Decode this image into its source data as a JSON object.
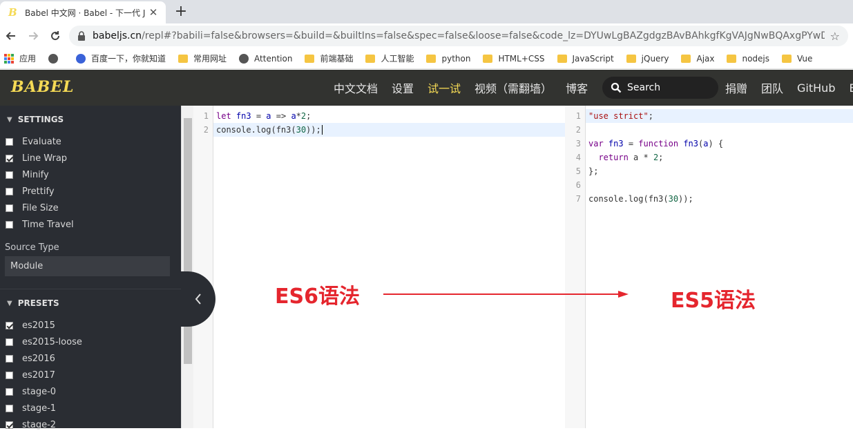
{
  "browser": {
    "tab_title": "Babel 中文网 · Babel - 下一代 J",
    "tab_close": "✕",
    "new_tab": "+",
    "url_host": "babeljs.cn",
    "url_rest": "/repl#?babili=false&browsers=&build=&builtIns=false&spec=false&loose=false&code_lz=DYUwLgBAZgdgzBAvBAhkgfKgVAJgNwBQAxgPYwDOJ..."
  },
  "bookmarks": [
    {
      "label": "应用",
      "icon": "apps-icon"
    },
    {
      "label": "",
      "icon": "globe-icon"
    },
    {
      "label": "百度一下，你就知道",
      "icon": "baidu-paw-icon"
    },
    {
      "label": "常用网址",
      "icon": "folder-icon"
    },
    {
      "label": "Attention",
      "icon": "globe-icon"
    },
    {
      "label": "前端基础",
      "icon": "folder-icon"
    },
    {
      "label": "人工智能",
      "icon": "folder-icon"
    },
    {
      "label": "python",
      "icon": "folder-icon"
    },
    {
      "label": "HTML+CSS",
      "icon": "folder-icon"
    },
    {
      "label": "JavaScript",
      "icon": "folder-icon"
    },
    {
      "label": "jQuery",
      "icon": "folder-icon"
    },
    {
      "label": "Ajax",
      "icon": "folder-icon"
    },
    {
      "label": "nodejs",
      "icon": "folder-icon"
    },
    {
      "label": "Vue",
      "icon": "folder-icon"
    }
  ],
  "header": {
    "logo": "BABEL",
    "nav": [
      "中文文档",
      "设置",
      "试一试",
      "视频（需翻墙）",
      "博客"
    ],
    "active_nav": "试一试",
    "search_label": "Search",
    "nav_right": [
      "捐赠",
      "团队",
      "GitHub",
      "Ba"
    ]
  },
  "sidebar": {
    "settings_title": "SETTINGS",
    "settings": [
      {
        "label": "Evaluate",
        "checked": false
      },
      {
        "label": "Line Wrap",
        "checked": true
      },
      {
        "label": "Minify",
        "checked": false
      },
      {
        "label": "Prettify",
        "checked": false
      },
      {
        "label": "File Size",
        "checked": false
      },
      {
        "label": "Time Travel",
        "checked": false
      }
    ],
    "source_type_label": "Source Type",
    "source_type_value": "Module",
    "presets_title": "PRESETS",
    "presets": [
      {
        "label": "es2015",
        "checked": true
      },
      {
        "label": "es2015-loose",
        "checked": false
      },
      {
        "label": "es2016",
        "checked": false
      },
      {
        "label": "es2017",
        "checked": false
      },
      {
        "label": "stage-0",
        "checked": false
      },
      {
        "label": "stage-1",
        "checked": false
      },
      {
        "label": "stage-2",
        "checked": true
      }
    ]
  },
  "input_editor": {
    "line_numbers": [
      "1",
      "2"
    ],
    "lines": [
      "let fn3 = a => a*2;",
      "console.log(fn3(30));"
    ]
  },
  "output_editor": {
    "line_numbers": [
      "1",
      "2",
      "3",
      "4",
      "5",
      "6",
      "7"
    ],
    "lines": [
      "\"use strict\";",
      "",
      "var fn3 = function fn3(a) {",
      "  return a * 2;",
      "};",
      "",
      "console.log(fn3(30));"
    ]
  },
  "annotations": {
    "left": "ES6语法",
    "right": "ES5语法",
    "color": "#e5262e"
  },
  "colors": {
    "babel_yellow": "#f5da55",
    "header_bg": "#323330",
    "sidebar_bg": "#2a2d33"
  }
}
